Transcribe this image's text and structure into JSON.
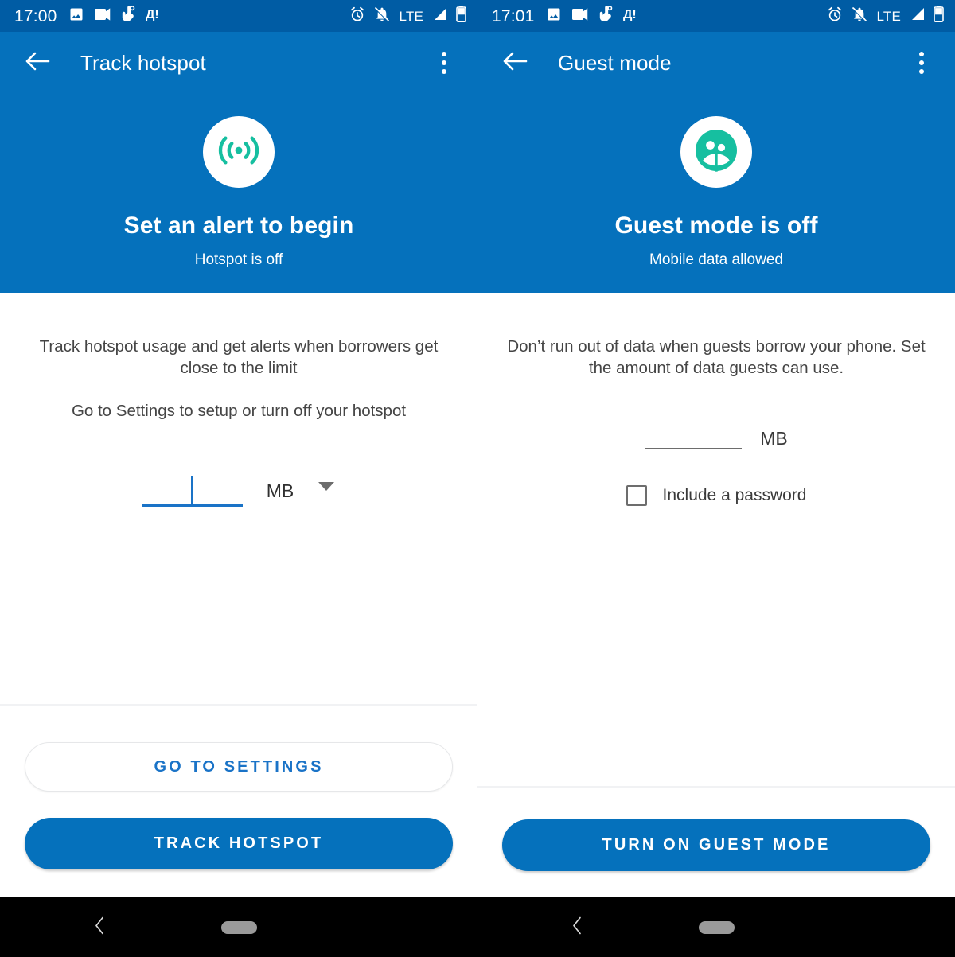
{
  "left": {
    "status": {
      "time": "17:00",
      "left_icons": [
        "image-icon",
        "videocam-icon",
        "vibrate-hand-icon",
        "cyrillic-d-alert-icon"
      ],
      "right_icons": [
        "alarm-icon",
        "notifications-off-icon",
        "signal-icon",
        "battery-icon"
      ],
      "network": "LTE"
    },
    "appbar": {
      "back": "back-arrow-icon",
      "title": "Track hotspot",
      "overflow": "more-vert-icon"
    },
    "hero": {
      "icon": "hotspot-broadcast-icon",
      "title": "Set an alert to begin",
      "subtitle": "Hotspot is off"
    },
    "body": {
      "desc1": "Track hotspot usage and get alerts when borrowers get close to the limit",
      "desc2": "Go to Settings to setup or turn off your hotspot",
      "amount_value": "",
      "amount_placeholder": "",
      "unit": "MB",
      "unit_dropdown": "chevron-down-icon"
    },
    "buttons": {
      "secondary": "GO TO SETTINGS",
      "primary": "TRACK HOTSPOT"
    }
  },
  "right": {
    "status": {
      "time": "17:01",
      "left_icons": [
        "image-icon",
        "videocam-icon",
        "vibrate-hand-icon",
        "cyrillic-d-alert-icon"
      ],
      "right_icons": [
        "alarm-icon",
        "notifications-off-icon",
        "signal-icon",
        "battery-icon"
      ],
      "network": "LTE"
    },
    "appbar": {
      "back": "back-arrow-icon",
      "title": "Guest mode",
      "overflow": "more-vert-icon"
    },
    "hero": {
      "icon": "guest-people-icon",
      "title": "Guest mode is off",
      "subtitle": "Mobile data allowed"
    },
    "body": {
      "desc1": "Don’t run out of data when guests borrow your phone. Set the amount of data guests can use.",
      "amount_value": "",
      "unit": "MB",
      "checkbox_label": "Include a password",
      "checkbox_checked": false
    },
    "buttons": {
      "primary": "TURN ON GUEST MODE"
    }
  },
  "nav": {
    "back": "nav-back-icon",
    "home": "nav-home-pill"
  },
  "colors": {
    "status_bar": "#005ca4",
    "app_bar": "#0571bc",
    "accent_teal": "#16bfa0",
    "primary_blue": "#0571bc",
    "link_blue": "#1a73c7",
    "body_text": "#454545"
  }
}
